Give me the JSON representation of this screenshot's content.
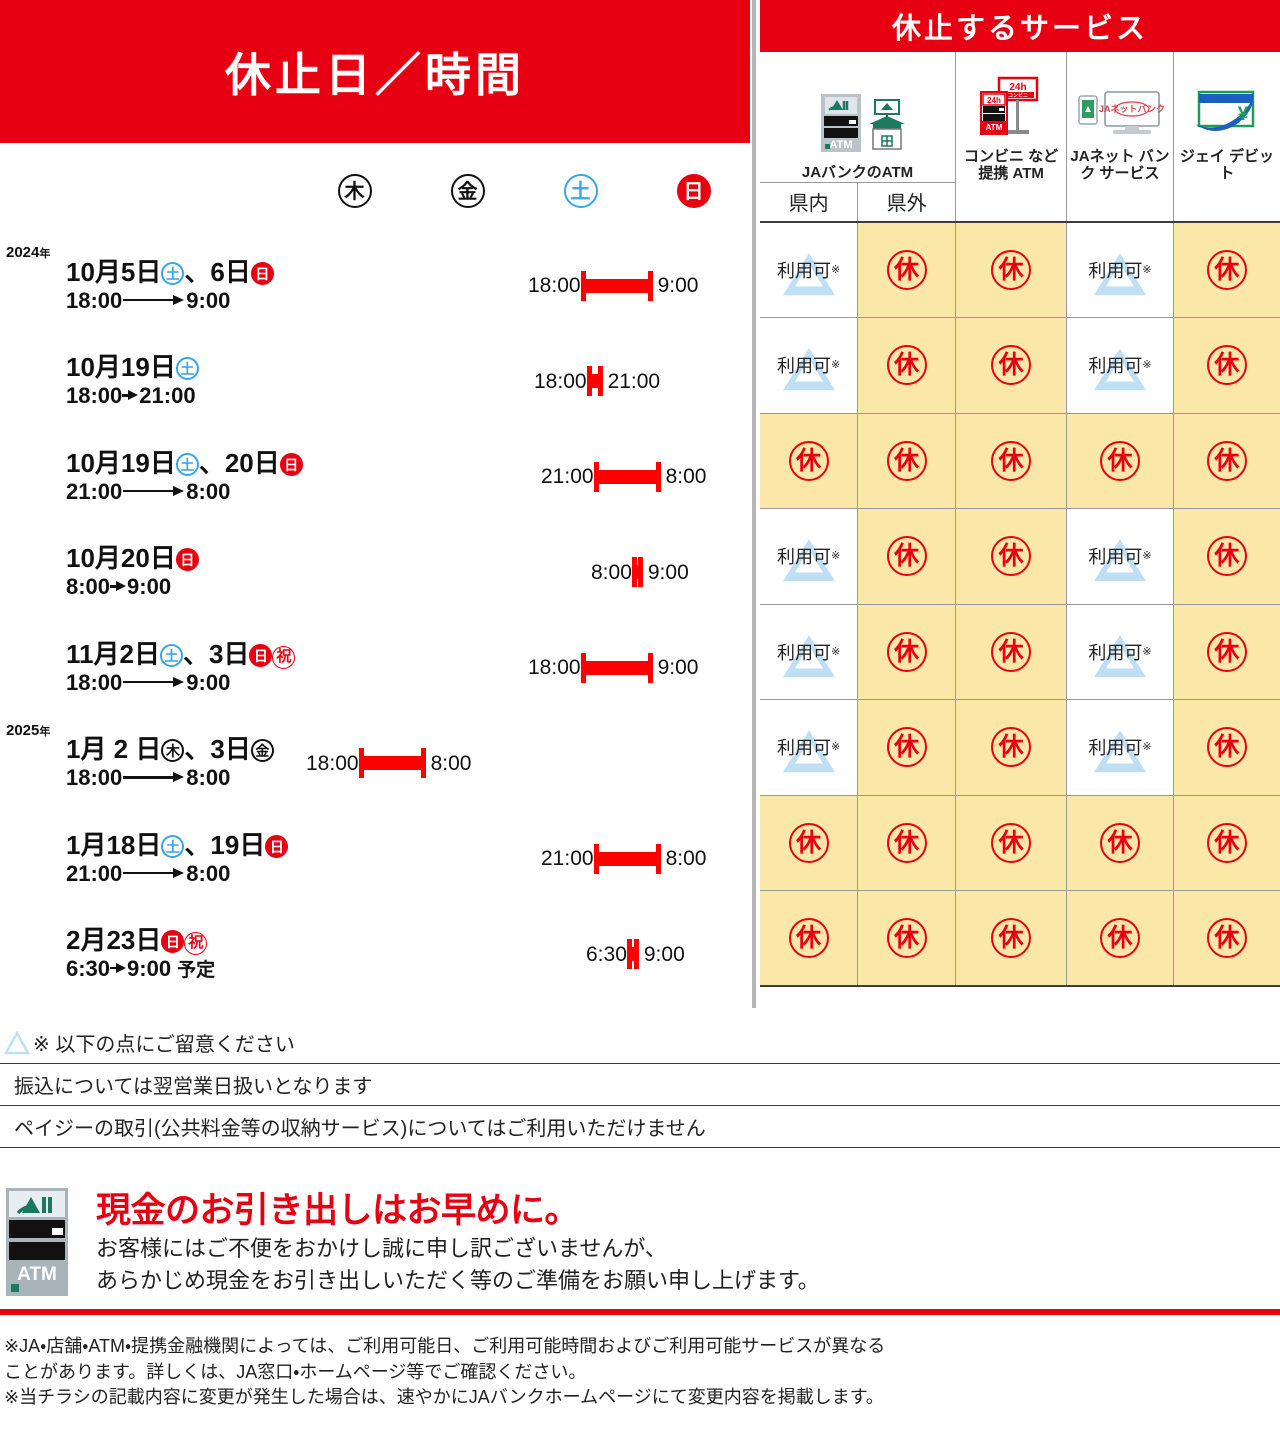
{
  "banners": {
    "left_title": "休止日／時間",
    "right_title": "休止するサービス"
  },
  "left_table": {
    "day_headers": [
      {
        "label": "木",
        "kind": "thu"
      },
      {
        "label": "金",
        "kind": "fri"
      },
      {
        "label": "土",
        "kind": "sat"
      },
      {
        "label": "日",
        "kind": "sun"
      }
    ],
    "rows": [
      {
        "year": "2024",
        "year_suffix": "年",
        "date_parts": [
          "10月5日",
          "、6日"
        ],
        "chips": [
          {
            "label": "土",
            "kind": "sat"
          },
          {
            "label": "日",
            "kind": "sun"
          }
        ],
        "holiday": null,
        "time_from": "18:00",
        "time_to": "9:00",
        "arrow": "long",
        "note": null,
        "bar_col": "sat-sun",
        "bar_left_label": "18:00",
        "bar_right_label": "9:00"
      },
      {
        "year": null,
        "date_parts": [
          "10月19日"
        ],
        "chips": [
          {
            "label": "土",
            "kind": "sat"
          }
        ],
        "holiday": null,
        "time_from": "18:00",
        "time_to": "21:00",
        "arrow": "short",
        "note": null,
        "bar_col": "sat",
        "bar_left_label": "18:00",
        "bar_right_label": "21:00"
      },
      {
        "year": null,
        "date_parts": [
          "10月19日",
          "、20日"
        ],
        "chips": [
          {
            "label": "土",
            "kind": "sat"
          },
          {
            "label": "日",
            "kind": "sun"
          }
        ],
        "holiday": null,
        "time_from": "21:00",
        "time_to": "8:00",
        "arrow": "long",
        "note": null,
        "bar_col": "sat-sun-late",
        "bar_left_label": "21:00",
        "bar_right_label": "8:00"
      },
      {
        "year": null,
        "date_parts": [
          "10月20日"
        ],
        "chips": [
          {
            "label": "日",
            "kind": "sun"
          }
        ],
        "holiday": null,
        "time_from": "8:00",
        "time_to": "9:00",
        "arrow": "short",
        "note": null,
        "bar_col": "sun",
        "bar_left_label": "8:00",
        "bar_right_label": "9:00"
      },
      {
        "year": null,
        "date_parts": [
          "11月2日",
          "、3日"
        ],
        "chips": [
          {
            "label": "土",
            "kind": "sat"
          },
          {
            "label": "日",
            "kind": "sun"
          }
        ],
        "holiday": "祝",
        "time_from": "18:00",
        "time_to": "9:00",
        "arrow": "long",
        "note": null,
        "bar_col": "sat-sun",
        "bar_left_label": "18:00",
        "bar_right_label": "9:00"
      },
      {
        "year": "2025",
        "year_suffix": "年",
        "date_parts": [
          "1月 2 日",
          "、3日"
        ],
        "chips": [
          {
            "label": "木",
            "kind": "thu"
          },
          {
            "label": "金",
            "kind": "fri"
          }
        ],
        "holiday": null,
        "time_from": "18:00",
        "time_to": "8:00",
        "arrow": "long",
        "note": null,
        "bar_col": "thu-fri",
        "bar_left_label": "18:00",
        "bar_right_label": "8:00"
      },
      {
        "year": null,
        "date_parts": [
          "1月18日",
          "、19日"
        ],
        "chips": [
          {
            "label": "土",
            "kind": "sat"
          },
          {
            "label": "日",
            "kind": "sun"
          }
        ],
        "holiday": null,
        "time_from": "21:00",
        "time_to": "8:00",
        "arrow": "long",
        "note": null,
        "bar_col": "sat-sun-late",
        "bar_left_label": "21:00",
        "bar_right_label": "8:00"
      },
      {
        "year": null,
        "date_parts": [
          "2月23日"
        ],
        "chips": [
          {
            "label": "日",
            "kind": "sun"
          }
        ],
        "holiday": "祝",
        "time_from": "6:30",
        "time_to": "9:00",
        "arrow": "short",
        "note": "予定",
        "bar_col": "sun-early",
        "bar_left_label": "6:30",
        "bar_right_label": "9:00"
      }
    ]
  },
  "right_table": {
    "service_columns": [
      {
        "id": "ja-atm",
        "label": "JAバンクのATM",
        "icon": "ja-atm-icon",
        "sub": [
          "県内",
          "県外"
        ]
      },
      {
        "id": "conveni-atm",
        "label": "コンビニ\nなど提携\nATM",
        "icon": "conveni-atm-icon",
        "sub": []
      },
      {
        "id": "ja-net-bank",
        "label": "JAネット\nバンク\nサービス",
        "icon": "ja-net-bank-icon",
        "sub": []
      },
      {
        "id": "j-debit",
        "label": "ジェイ\nデビット",
        "icon": "j-debit-icon",
        "sub": []
      }
    ],
    "status_labels": {
      "closed": "休",
      "available": "利用可",
      "available_mark": "※"
    },
    "status_rows": [
      [
        "available",
        "closed",
        "closed",
        "available",
        "closed"
      ],
      [
        "available",
        "closed",
        "closed",
        "available",
        "closed"
      ],
      [
        "closed",
        "closed",
        "closed",
        "closed",
        "closed"
      ],
      [
        "available",
        "closed",
        "closed",
        "available",
        "closed"
      ],
      [
        "available",
        "closed",
        "closed",
        "available",
        "closed"
      ],
      [
        "available",
        "closed",
        "closed",
        "available",
        "closed"
      ],
      [
        "closed",
        "closed",
        "closed",
        "closed",
        "closed"
      ],
      [
        "closed",
        "closed",
        "closed",
        "closed",
        "closed"
      ]
    ]
  },
  "notes": {
    "head": "※ 以下の点にご留意ください",
    "lines": [
      "振込については翌営業日扱いとなります",
      "ペイジーの取引(公共料金等の収納サービス)についてはご利用いただけません"
    ]
  },
  "appeal": {
    "heading": "現金のお引き出しはお早めに。",
    "line1": "お客様にはご不便をおかけし誠に申し訳ございませんが、",
    "line2": "あらかじめ現金をお引き出しいただく等のご準備をお願い申し上げます。",
    "atm_label": "ATM"
  },
  "footnotes": {
    "note1": "※JA・店舗・ATM・提携金融機関によっては、ご利用可能日、ご利用可能時間およびご利用可能サービスが異なる\n   ことがあります。詳しくは、JA窓口・ホームページ等でご確認ください。",
    "note2": "※当チラシの記載内容に変更が発生した場合は、速やかにJAバンクホームページにて変更内容を掲載します。"
  },
  "colors": {
    "brand_red": "#e60012",
    "bar_red": "#ff0000",
    "closed_bg": "#fbe7a8",
    "sat_blue": "#3aa5e0",
    "ja_green": "#1a7a5e"
  }
}
